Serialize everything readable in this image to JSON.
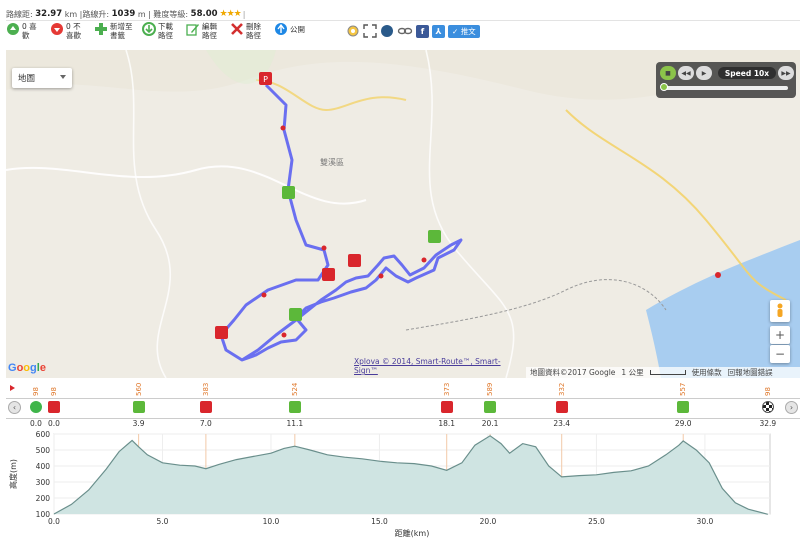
{
  "stats": {
    "distance_label": "路線距:",
    "distance_value": "32.97",
    "distance_unit": "km",
    "climb_label": "|路線升:",
    "climb_value": "1039",
    "climb_unit": "m",
    "difficulty_label": "| 難度等級:",
    "difficulty_value": "58.00",
    "stars": "★★★"
  },
  "actions": [
    {
      "name": "like",
      "icon": "thumb-up-icon",
      "label": "0 喜歡",
      "color": "#4caf50"
    },
    {
      "name": "dislike",
      "icon": "thumb-down-icon",
      "label": "0 不喜歡",
      "color": "#e53935"
    },
    {
      "name": "add-favorite",
      "icon": "plus-icon",
      "label": "新增至書籤",
      "color": "#4caf50"
    },
    {
      "name": "download",
      "icon": "download-icon",
      "label": "下載路徑",
      "color": "#4caf50"
    },
    {
      "name": "edit",
      "icon": "edit-icon",
      "label": "編輯路徑",
      "color": "#4caf50"
    },
    {
      "name": "delete",
      "icon": "delete-icon",
      "label": "刪除路徑",
      "color": "#d32f2f"
    },
    {
      "name": "public",
      "icon": "globe-icon",
      "label": "公開",
      "color": "#1e88e5"
    }
  ],
  "social": {
    "share_label": "推文",
    "colors": {
      "facebook": "#3b5998",
      "share": "#3b8ede"
    }
  },
  "map": {
    "map_type": "地圖",
    "speed_label": "Speed 10x",
    "place_label": "雙溪區",
    "credits": "Xplova © 2014, Smart-Route™, Smart-Sign™",
    "map_data": "地圖資料©2017 Google",
    "scale": "1 公里",
    "terms": "使用條款",
    "report": "回報地圖錯誤",
    "google": "Google",
    "zoom_in": "+",
    "zoom_out": "−",
    "route_color": "#6a6ff0"
  },
  "markers": {
    "elevation_tags": [
      "98",
      "98",
      "560",
      "383",
      "524",
      "373",
      "589",
      "332",
      "557",
      "98"
    ],
    "km_tags": [
      "0.0",
      "0.0",
      "3.9",
      "7.0",
      "11.1",
      "18.1",
      "20.1",
      "23.4",
      "29.0",
      "32.9"
    ],
    "types": [
      "start",
      "red",
      "green",
      "red",
      "green",
      "red",
      "green",
      "red",
      "green",
      "flag"
    ]
  },
  "chart_data": {
    "type": "area",
    "ylabel": "高度(m)",
    "xlabel": "距離(km)",
    "ylim": [
      0,
      600
    ],
    "xlim": [
      0,
      33
    ],
    "yticks": [
      "100",
      "200",
      "300",
      "400",
      "500",
      "600"
    ],
    "xticks": [
      "0.0",
      "5.0",
      "10.0",
      "15.0",
      "20.0",
      "25.0",
      "30.0"
    ],
    "x": [
      0,
      0.8,
      1.6,
      2.4,
      3.0,
      3.6,
      3.9,
      4.3,
      5.0,
      5.8,
      6.5,
      7.0,
      7.6,
      8.4,
      9.2,
      10.0,
      10.6,
      11.1,
      11.8,
      12.6,
      13.4,
      14.2,
      15.0,
      15.8,
      16.6,
      17.4,
      18.1,
      18.8,
      19.4,
      20.1,
      20.6,
      21.0,
      21.6,
      22.2,
      22.8,
      23.4,
      24.2,
      25.0,
      25.8,
      26.6,
      27.4,
      28.2,
      28.8,
      29.0,
      29.6,
      30.2,
      30.8,
      31.4,
      32.0,
      32.9
    ],
    "y": [
      100,
      160,
      250,
      380,
      490,
      560,
      520,
      470,
      420,
      405,
      400,
      383,
      410,
      440,
      460,
      480,
      510,
      524,
      500,
      470,
      455,
      445,
      430,
      420,
      415,
      400,
      373,
      420,
      530,
      589,
      540,
      480,
      540,
      520,
      400,
      332,
      340,
      345,
      360,
      370,
      400,
      470,
      530,
      557,
      500,
      420,
      260,
      170,
      130,
      98
    ],
    "fill_color": "#cfe4e2",
    "line_color": "#6a8f8c"
  }
}
